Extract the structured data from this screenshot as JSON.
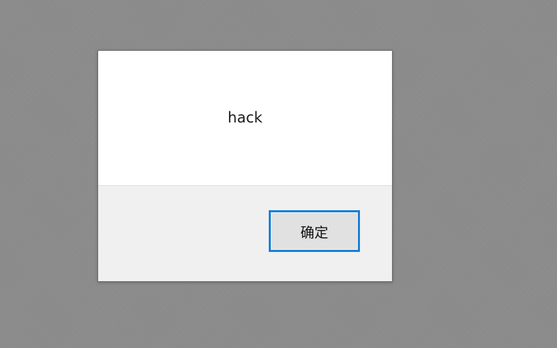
{
  "dialog": {
    "message": "hack",
    "ok_button_label": "确定"
  },
  "colors": {
    "backdrop": "#8c8c8c",
    "dialog_body": "#ffffff",
    "button_area": "#f0f0f0",
    "button_focus_border": "#1a7fd6",
    "button_face": "#e1e1e1"
  }
}
